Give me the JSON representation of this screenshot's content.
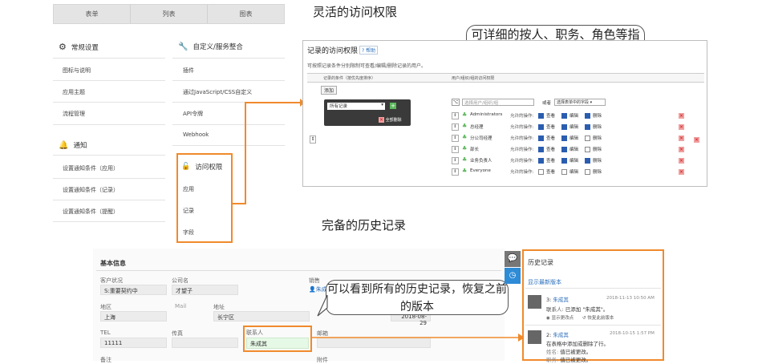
{
  "headings": {
    "access": "灵活的访问权限",
    "history": "完备的历史记录"
  },
  "tabs": [
    "表单",
    "列表",
    "图表"
  ],
  "settings": {
    "general": {
      "title": "常规设置",
      "items": [
        "图标与说明",
        "应用主题",
        "流程管理"
      ]
    },
    "custom": {
      "title": "自定义/服务整合",
      "items": [
        "插件",
        "通过JavaScript/CSS自定义",
        "API令牌",
        "Webhook"
      ]
    },
    "notify": {
      "title": "通知",
      "items": [
        "设置通知条件（应用）",
        "设置通知条件（记录）",
        "设置通知条件（提醒）"
      ]
    },
    "access": {
      "title": "访问权限",
      "items": [
        "应用",
        "记录",
        "字段"
      ]
    }
  },
  "callouts": {
    "top": "可详细的按人、职务、角色等指定各种权限",
    "bottom": "可以看到所有的历史记录，恢复之前的版本"
  },
  "perm": {
    "title": "记录的访问权限",
    "help": "帮助",
    "desc": "可按照记录条件分别限制可查看/编辑/删除记录的用户。",
    "col1": "记录的条件（按优先度排序）",
    "col2": "用户/组织/组的访问权限",
    "add": "添加",
    "cond": "所有记录",
    "delall": "全部删除",
    "placeholder": "选择用户/组织/组",
    "or": "或者",
    "field_select": "选择表单中的字段",
    "rows": [
      {
        "name": "Administrators",
        "allow": "允许的操作:",
        "view": true,
        "edit": true,
        "del": true
      },
      {
        "name": "总经理",
        "allow": "允许的操作:",
        "view": true,
        "edit": true,
        "del": true
      },
      {
        "name": "分公司经理",
        "allow": "允许的操作:",
        "view": true,
        "edit": true,
        "del": false
      },
      {
        "name": "部长",
        "allow": "允许的操作:",
        "view": true,
        "edit": true,
        "del": false
      },
      {
        "name": "业务负责人",
        "allow": "允许的操作:",
        "view": true,
        "edit": true,
        "del": true
      },
      {
        "name": "Everyone",
        "allow": "允许的操作:",
        "view": false,
        "edit": false,
        "del": false
      }
    ],
    "view": "查看",
    "edit": "编辑",
    "del": "删除"
  },
  "form": {
    "section": "基本信息",
    "status_l": "客户状况",
    "status_v": "S:重要契约中",
    "company_l": "公司名",
    "company_v": "才望子",
    "sales_l": "销售",
    "sales_v": "朱成其",
    "region_l": "地区",
    "region_v": "上海",
    "mail_l": "Mail",
    "addr_l": "地址",
    "addr_v": "长宁区",
    "date_v": "2018-08-29",
    "tel_l": "TEL",
    "tel_v": "11111",
    "fax_l": "传真",
    "contact_l": "联系人",
    "contact_v": "朱成其",
    "email_l": "邮箱",
    "memo_l": "备注",
    "att_l": "附件"
  },
  "history": {
    "title": "历史记录",
    "latest": "显示最新版本",
    "entries": [
      {
        "no": "3:",
        "user": "朱成其",
        "time": "2018-11-13 10:50 AM",
        "l1k": "联系人:",
        "l1v": "已添加 \"朱成其\"。",
        "a": "显示更改点",
        "b": "恢复此前版本"
      },
      {
        "no": "2:",
        "user": "朱成其",
        "time": "2018-10-15 1:57 PM",
        "l1k": "在表格中添加或删除了行。",
        "l2k": "姓名:",
        "l2v": "值已被更改。",
        "l3k": "职务:",
        "l3v": "值已被更改。"
      }
    ]
  },
  "colors": {
    "accent": "#f08a2c",
    "link": "#2a6ebb",
    "green": "#5cb85c",
    "red": "#d9534f"
  }
}
